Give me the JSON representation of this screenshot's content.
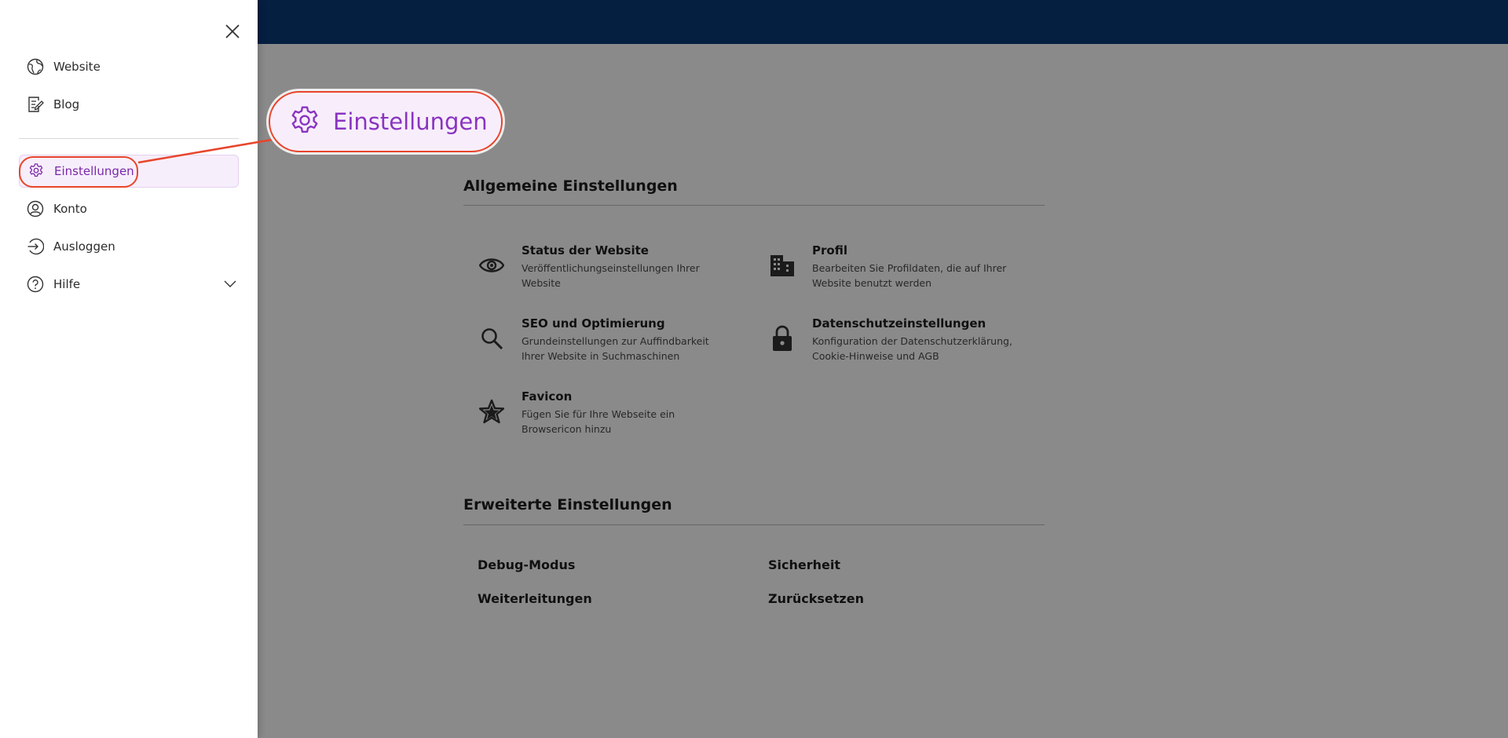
{
  "drawer": {
    "close_icon": "close-icon",
    "items": [
      {
        "label": "Website",
        "icon": "globe-icon"
      },
      {
        "label": "Blog",
        "icon": "document-edit-icon"
      },
      {
        "label": "Einstellungen",
        "icon": "gear-icon",
        "active": true
      },
      {
        "label": "Konto",
        "icon": "user-circle-icon"
      },
      {
        "label": "Ausloggen",
        "icon": "logout-icon"
      },
      {
        "label": "Hilfe",
        "icon": "help-circle-icon",
        "expandable": true
      }
    ]
  },
  "callout": {
    "label": "Einstellungen",
    "icon": "gear-icon"
  },
  "general": {
    "title": "Allgemeine Einstellungen",
    "settings": [
      {
        "title": "Status der Website",
        "desc": "Veröffentlichungseinstellungen Ihrer Website",
        "icon": "eye-icon"
      },
      {
        "title": "Profil",
        "desc": "Bearbeiten Sie Profildaten, die auf Ihrer Website benutzt werden",
        "icon": "building-icon"
      },
      {
        "title": "SEO und Optimierung",
        "desc": "Grundeinstellungen zur Auffindbarkeit Ihrer Website in Suchmaschinen",
        "icon": "search-icon"
      },
      {
        "title": "Datenschutzeinstellungen",
        "desc": "Konfiguration der Datenschutzerklärung, Cookie-Hinweise und AGB",
        "icon": "lock-icon"
      },
      {
        "title": "Favicon",
        "desc": "Fügen Sie für Ihre Webseite ein Browsericon hinzu",
        "icon": "star-icon"
      }
    ]
  },
  "advanced": {
    "title": "Erweiterte Einstellungen",
    "links": [
      "Debug-Modus",
      "Sicherheit",
      "Weiterleitungen",
      "Zurücksetzen"
    ]
  },
  "colors": {
    "topbar": "#0a3a78",
    "accent": "#8a34c0",
    "annotation": "#e8452c"
  }
}
